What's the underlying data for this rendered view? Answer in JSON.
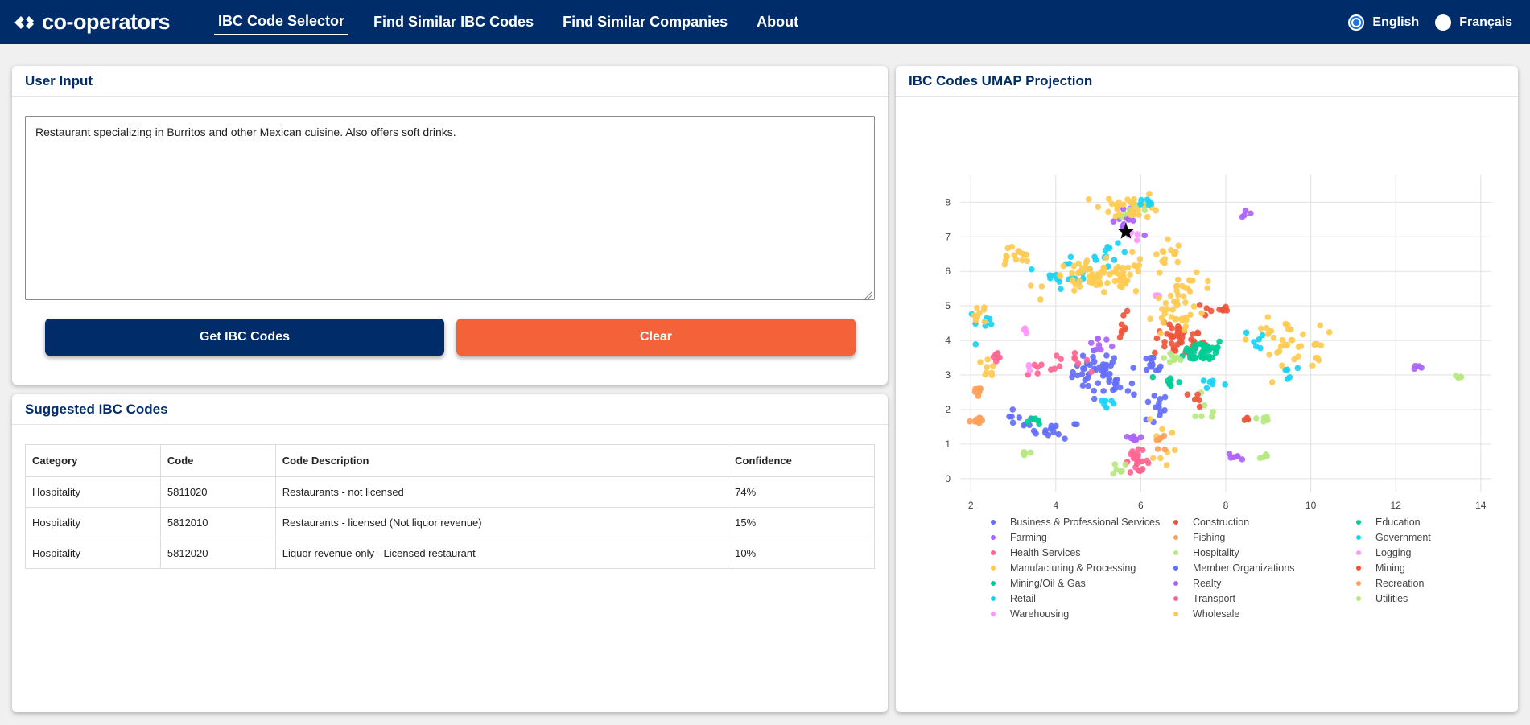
{
  "header": {
    "brand": "co-operators",
    "nav": [
      {
        "label": "IBC Code Selector",
        "active": true
      },
      {
        "label": "Find Similar IBC Codes",
        "active": false
      },
      {
        "label": "Find Similar Companies",
        "active": false
      },
      {
        "label": "About",
        "active": false
      }
    ],
    "languages": [
      {
        "label": "English",
        "selected": true
      },
      {
        "label": "Français",
        "selected": false
      }
    ]
  },
  "input_panel": {
    "title": "User Input",
    "description": "Restaurant specializing in Burritos and other Mexican cuisine. Also offers soft drinks.",
    "get_button": "Get IBC Codes",
    "clear_button": "Clear"
  },
  "codes_panel": {
    "title": "Suggested IBC Codes",
    "columns": [
      "Category",
      "Code",
      "Code Description",
      "Confidence"
    ],
    "rows": [
      {
        "category": "Hospitality",
        "code": "5811020",
        "description": "Restaurants - not licensed",
        "confidence": "74%"
      },
      {
        "category": "Hospitality",
        "code": "5812010",
        "description": "Restaurants - licensed (Not liquor revenue)",
        "confidence": "15%"
      },
      {
        "category": "Hospitality",
        "code": "5812020",
        "description": "Liquor revenue only - Licensed restaurant",
        "confidence": "10%"
      }
    ]
  },
  "umap_panel": {
    "title": "IBC Codes UMAP Projection",
    "chart_data": {
      "type": "scatter",
      "title": "",
      "xlabel": "",
      "ylabel": "",
      "xlim": [
        1.75,
        14.25
      ],
      "ylim": [
        -0.4,
        8.8
      ],
      "x_ticks": [
        2,
        4,
        6,
        8,
        10,
        12,
        14
      ],
      "y_ticks": [
        0,
        1,
        2,
        3,
        4,
        5,
        6,
        7,
        8
      ],
      "grid": true,
      "legend_position": "bottom",
      "query_point": {
        "x": 5.65,
        "y": 7.15,
        "marker": "star"
      },
      "series": [
        {
          "name": "Business & Professional Services",
          "color": "#636efa",
          "clusters": [
            [
              5.0,
              3.1,
              0.5,
              0.5,
              40
            ],
            [
              4.0,
              1.4,
              0.5,
              0.2,
              15
            ],
            [
              6.3,
              2.0,
              0.3,
              0.4,
              12
            ],
            [
              3.1,
              1.7,
              0.3,
              0.2,
              8
            ]
          ]
        },
        {
          "name": "Construction",
          "color": "#ef553b",
          "clusters": [
            [
              6.9,
              4.0,
              0.5,
              0.4,
              40
            ],
            [
              7.8,
              4.9,
              0.3,
              0.2,
              10
            ],
            [
              5.5,
              4.5,
              0.2,
              0.4,
              8
            ]
          ]
        },
        {
          "name": "Education",
          "color": "#00cc96",
          "clusters": [
            [
              7.5,
              3.7,
              0.4,
              0.3,
              35
            ],
            [
              6.7,
              2.8,
              0.2,
              0.2,
              8
            ],
            [
              3.5,
              1.7,
              0.2,
              0.1,
              6
            ]
          ]
        },
        {
          "name": "Farming",
          "color": "#ab63fa",
          "clusters": [
            [
              8.45,
              7.7,
              0.1,
              0.1,
              4
            ],
            [
              12.5,
              3.25,
              0.1,
              0.05,
              4
            ],
            [
              5.6,
              7.4,
              0.3,
              0.3,
              12
            ],
            [
              8.3,
              0.65,
              0.2,
              0.1,
              6
            ],
            [
              5.0,
              3.9,
              0.3,
              0.3,
              8
            ]
          ]
        },
        {
          "name": "Fishing",
          "color": "#ffa15a",
          "clusters": [
            [
              2.1,
              1.7,
              0.1,
              0.1,
              8
            ],
            [
              2.2,
              2.5,
              0.2,
              0.2,
              8
            ]
          ]
        },
        {
          "name": "Government",
          "color": "#19d3f3",
          "clusters": [
            [
              4.3,
              6.0,
              0.5,
              0.4,
              20
            ],
            [
              5.3,
              6.4,
              0.3,
              0.3,
              10
            ],
            [
              2.3,
              4.5,
              0.3,
              0.3,
              8
            ],
            [
              5.2,
              2.2,
              0.2,
              0.2,
              6
            ],
            [
              8.8,
              4.0,
              0.3,
              0.3,
              6
            ],
            [
              9.5,
              3.2,
              0.2,
              0.2,
              5
            ]
          ]
        },
        {
          "name": "Health Services",
          "color": "#ff6692",
          "clusters": [
            [
              5.9,
              0.5,
              0.25,
              0.25,
              25
            ],
            [
              4.3,
              3.4,
              0.4,
              0.2,
              10
            ],
            [
              2.6,
              3.4,
              0.2,
              0.2,
              6
            ]
          ]
        },
        {
          "name": "Hospitality",
          "color": "#b6e880",
          "clusters": [
            [
              5.9,
              7.8,
              0.3,
              0.2,
              10
            ],
            [
              8.9,
              0.65,
              0.1,
              0.15,
              5
            ],
            [
              13.5,
              2.95,
              0.1,
              0.05,
              4
            ],
            [
              3.3,
              0.75,
              0.15,
              0.1,
              5
            ],
            [
              8.9,
              1.75,
              0.15,
              0.15,
              6
            ],
            [
              6.8,
              3.5,
              0.2,
              0.2,
              8
            ],
            [
              7.5,
              1.9,
              0.3,
              0.3,
              6
            ]
          ]
        },
        {
          "name": "Logging",
          "color": "#ff97ff",
          "clusters": [
            [
              3.3,
              4.3,
              0.1,
              0.1,
              5
            ],
            [
              5.8,
              7.0,
              0.2,
              0.1,
              4
            ],
            [
              6.4,
              5.3,
              0.1,
              0.1,
              3
            ]
          ]
        },
        {
          "name": "Manufacturing & Processing",
          "color": "#fecb52",
          "clusters": [
            [
              5.0,
              5.8,
              1.0,
              0.4,
              70
            ],
            [
              5.8,
              7.9,
              0.6,
              0.3,
              30
            ],
            [
              7.1,
              5.4,
              0.6,
              0.4,
              25
            ],
            [
              9.3,
              4.0,
              0.6,
              0.5,
              30
            ],
            [
              3.0,
              6.4,
              0.4,
              0.3,
              15
            ],
            [
              6.5,
              1.2,
              0.3,
              0.6,
              10
            ],
            [
              10.1,
              3.7,
              0.1,
              0.6,
              8
            ],
            [
              2.4,
              3.2,
              0.3,
              0.3,
              8
            ]
          ]
        },
        {
          "name": "Member Organizations",
          "color": "#636efa",
          "clusters": [
            [
              6.2,
              3.2,
              0.3,
              0.3,
              12
            ],
            [
              5.5,
              2.6,
              0.3,
              0.3,
              10
            ]
          ]
        },
        {
          "name": "Mining",
          "color": "#ef553b",
          "clusters": [
            [
              7.3,
              2.3,
              0.2,
              0.2,
              5
            ],
            [
              8.5,
              1.7,
              0.1,
              0.1,
              4
            ]
          ]
        },
        {
          "name": "Mining/Oil & Gas",
          "color": "#00cc96",
          "clusters": [
            [
              7.2,
              3.6,
              0.2,
              0.2,
              8
            ]
          ]
        },
        {
          "name": "Realty",
          "color": "#ab63fa",
          "clusters": [
            [
              5.8,
              1.2,
              0.2,
              0.2,
              8
            ]
          ]
        },
        {
          "name": "Recreation",
          "color": "#ffa15a",
          "clusters": [
            [
              6.5,
              1.0,
              0.2,
              0.3,
              6
            ]
          ]
        },
        {
          "name": "Retail",
          "color": "#19d3f3",
          "clusters": [
            [
              6.2,
              8.0,
              0.2,
              0.1,
              6
            ],
            [
              7.6,
              2.8,
              0.3,
              0.2,
              6
            ]
          ]
        },
        {
          "name": "Transport",
          "color": "#ff6692",
          "clusters": [
            [
              3.6,
              3.2,
              0.3,
              0.2,
              6
            ]
          ]
        },
        {
          "name": "Utilities",
          "color": "#b6e880",
          "clusters": [
            [
              5.5,
              0.3,
              0.2,
              0.2,
              6
            ]
          ]
        },
        {
          "name": "Warehousing",
          "color": "#ff97ff",
          "clusters": [
            [
              3.4,
              3.3,
              0.1,
              0.1,
              3
            ]
          ]
        },
        {
          "name": "Wholesale",
          "color": "#fecb52",
          "clusters": [
            [
              6.9,
              4.6,
              0.6,
              0.4,
              20
            ],
            [
              6.5,
              6.5,
              0.4,
              0.4,
              15
            ],
            [
              2.2,
              4.8,
              0.2,
              0.3,
              8
            ]
          ]
        }
      ]
    }
  }
}
